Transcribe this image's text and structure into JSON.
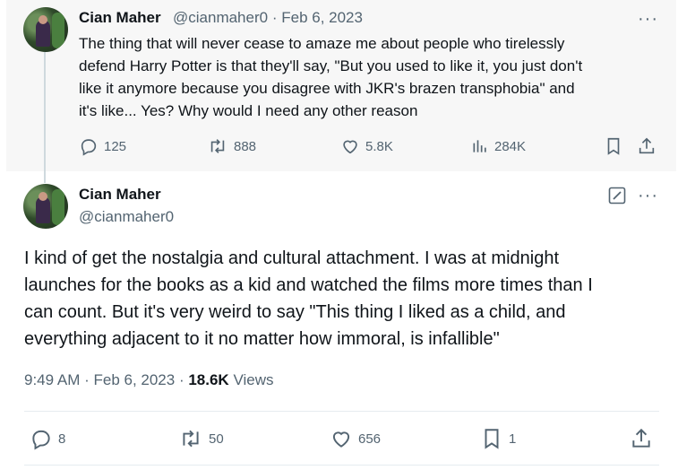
{
  "parent": {
    "name": "Cian Maher",
    "handle": "@cianmaher0",
    "sep": "·",
    "date": "Feb 6, 2023",
    "lines": [
      "The thing that will never cease to amaze me about people who tirelessly",
      "defend Harry Potter is that they'll say, \"But you used to like it, you just don't",
      "like it anymore because you disagree with JKR's brazen transphobia\" and",
      "it's like... Yes? Why would I need any other reason"
    ],
    "actions": {
      "replies": "125",
      "reposts": "888",
      "likes": "5.8K",
      "views": "284K"
    }
  },
  "main": {
    "name": "Cian Maher",
    "handle": "@cianmaher0",
    "lines": [
      "I kind of get the nostalgia and cultural attachment. I was at midnight",
      "launches for the books as a kid and watched the films more times than I",
      "can count. But it's very weird to say \"This thing I liked as a child, and",
      "everything adjacent to it no matter how immoral, is infallible\""
    ],
    "meta": {
      "time": "9:49 AM",
      "sep1": " · ",
      "date": "Feb 6, 2023",
      "sep2": " · ",
      "views_count": "18.6K",
      "views_label": " Views"
    },
    "actions": {
      "replies": "8",
      "reposts": "50",
      "likes": "656",
      "bookmarks": "1"
    }
  },
  "more_label": "···",
  "icons": [
    "reply-icon",
    "repost-icon",
    "like-icon",
    "views-icon",
    "bookmark-icon",
    "share-icon",
    "edit-icon",
    "more-icon"
  ],
  "colors": {
    "text": "#0f1419",
    "secondary": "#536471",
    "parent_bg": "#f7f7f7",
    "line": "#cfd9de"
  }
}
